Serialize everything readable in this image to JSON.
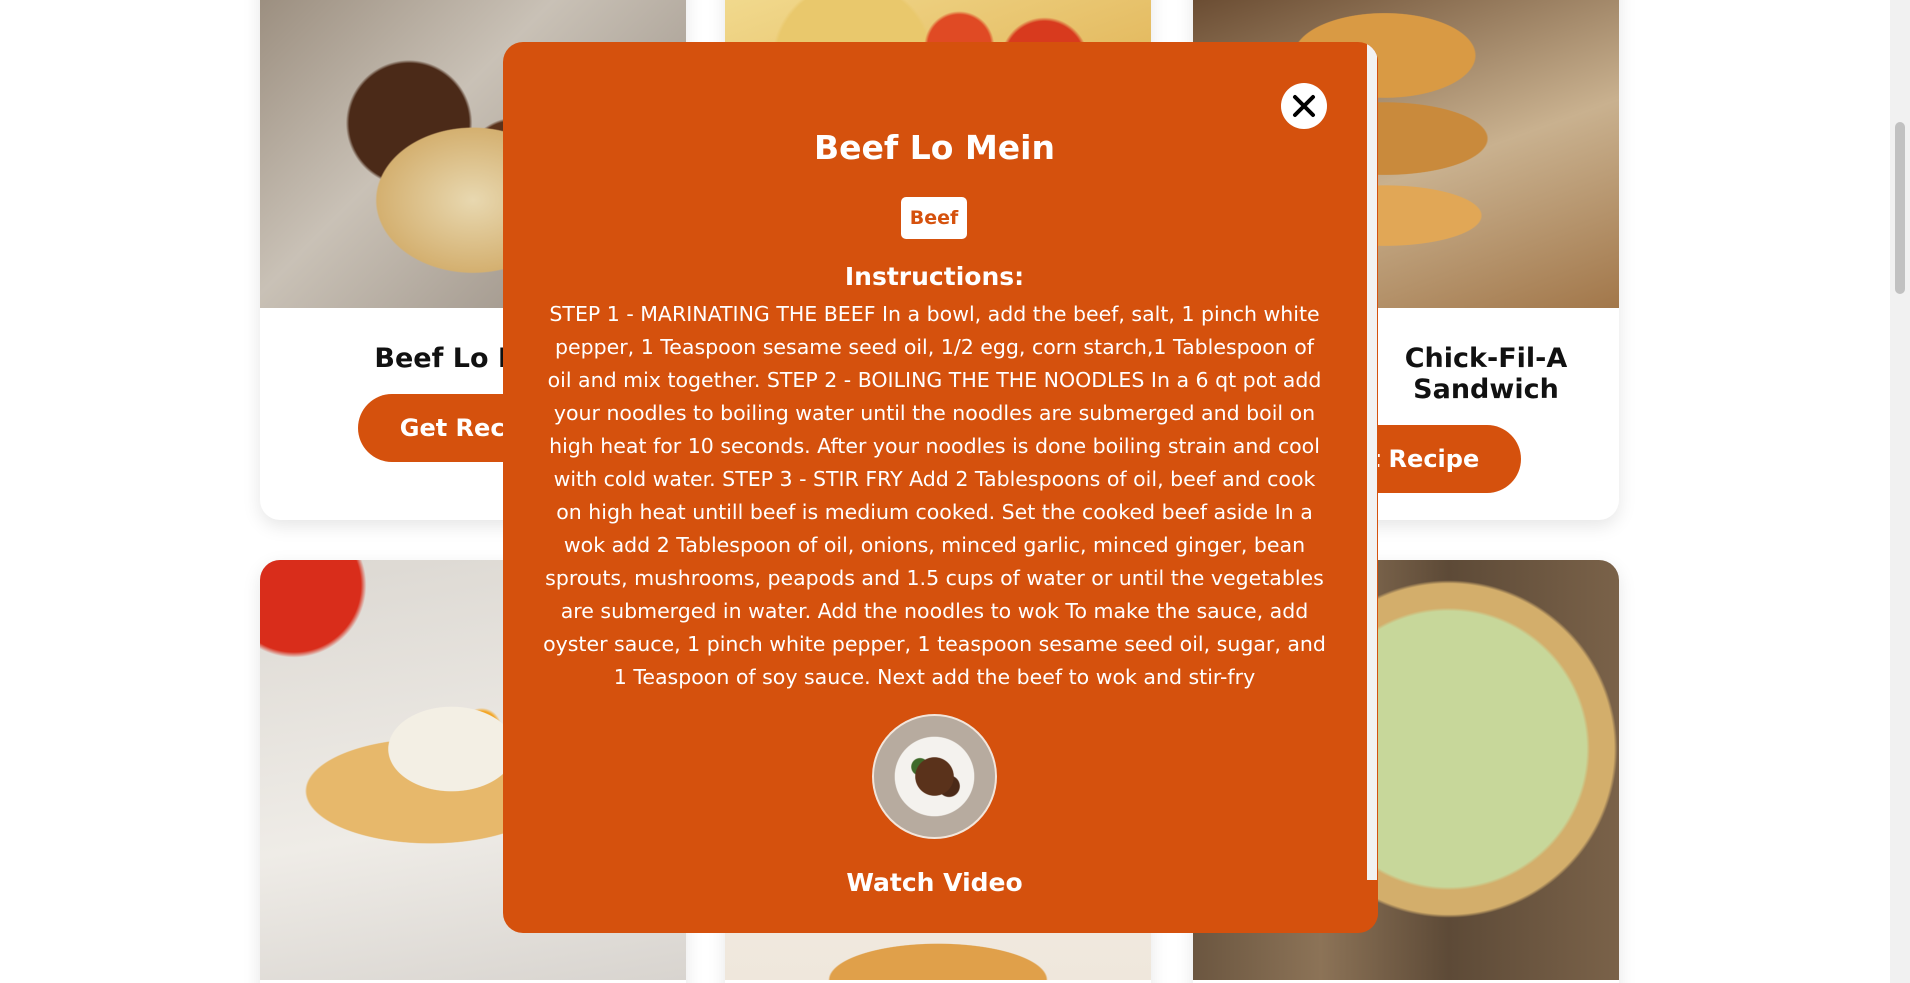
{
  "cards": [
    {
      "title": "Beef Lo Mein",
      "button": "Get Recipe"
    },
    {
      "title": "",
      "button": ""
    },
    {
      "title": "Chick-Fil-A Sandwich",
      "button": "Get Recipe"
    }
  ],
  "modal": {
    "title": "Beef Lo Mein",
    "category": "Beef",
    "instructions_heading": "Instructions:",
    "instructions": "STEP 1 - MARINATING THE BEEF In a bowl, add the beef, salt, 1 pinch white pepper, 1 Teaspoon sesame seed oil, 1/2 egg, corn starch,1 Tablespoon of oil and mix together. STEP 2 - BOILING THE THE NOODLES In a 6 qt pot add your noodles to boiling water until the noodles are submerged and boil on high heat for 10 seconds. After your noodles is done boiling strain and cool with cold water. STEP 3 - STIR FRY Add 2 Tablespoons of oil, beef and cook on high heat untill beef is medium cooked. Set the cooked beef aside In a wok add 2 Tablespoon of oil, onions, minced garlic, minced ginger, bean sprouts, mushrooms, peapods and 1.5 cups of water or until the vegetables are submerged in water. Add the noodles to wok To make the sauce, add oyster sauce, 1 pinch white pepper, 1 teaspoon sesame seed oil, sugar, and 1 Teaspoon of soy sauce. Next add the beef to wok and stir-fry",
    "watch_video": "Watch Video",
    "close_icon": "close-icon"
  },
  "colors": {
    "accent": "#d5510d",
    "background": "#ffffff",
    "text": "#111111"
  }
}
